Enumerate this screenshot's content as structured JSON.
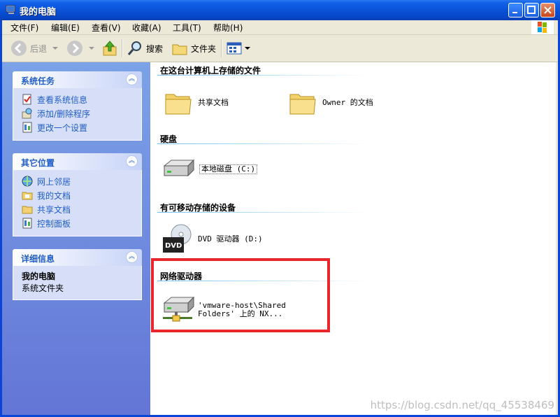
{
  "window": {
    "title": "我的电脑"
  },
  "menu": [
    "文件(F)",
    "编辑(E)",
    "查看(V)",
    "收藏(A)",
    "工具(T)",
    "帮助(H)"
  ],
  "toolbar": {
    "back": "后退",
    "search": "搜索",
    "folders": "文件夹"
  },
  "tasks": {
    "system": {
      "title": "系统任务",
      "items": [
        "查看系统信息",
        "添加/删除程序",
        "更改一个设置"
      ]
    },
    "other": {
      "title": "其它位置",
      "items": [
        "网上邻居",
        "我的文档",
        "共享文档",
        "控制面板"
      ]
    },
    "details": {
      "title": "详细信息",
      "name": "我的电脑",
      "desc": "系统文件夹"
    }
  },
  "groups": {
    "files": {
      "title": "在这台计算机上存储的文件",
      "items": [
        "共享文档",
        "Owner 的文档"
      ]
    },
    "disks": {
      "title": "硬盘",
      "items": [
        "本地磁盘 (C:)"
      ]
    },
    "removable": {
      "title": "有可移动存储的设备",
      "items": [
        "DVD 驱动器 (D:)"
      ]
    },
    "network": {
      "title": "网络驱动器",
      "line1": "'vmware-host\\Shared",
      "line2": "Folders' 上的 NX..."
    }
  },
  "watermark": "https://blog.csdn.net/qq_45538469"
}
